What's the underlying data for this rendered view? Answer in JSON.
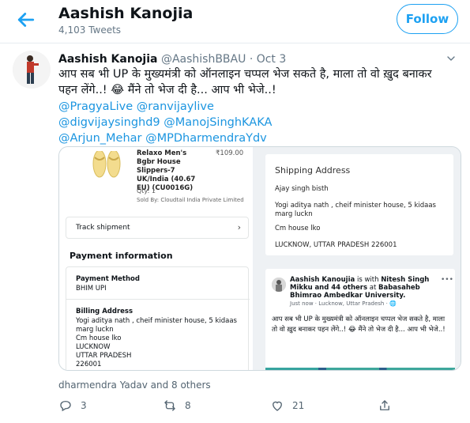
{
  "header": {
    "name": "Aashish Kanojia",
    "tweet_count": "4,103 Tweets",
    "follow_label": "Follow"
  },
  "tweet": {
    "author_name": "Aashish Kanojia",
    "author_handle": "@AashishBBAU",
    "separator": "·",
    "date": "Oct 3",
    "text_line1": "आप सब भी UP के मुख्यमंत्री को ऑनलाइन चप्पल भेज सकते है, माला तो वो ख़ुद बनाकर",
    "text_line2": "पहन लेंगे..! 😂 मैंने तो भेज दी है... आप भी भेजे..!",
    "mentions": [
      "@PragyaLive @ranvijaylive",
      "@digvijaysinghd9 @ManojSinghKAKA",
      "@Arjun_Mehar @MPDharmendraYdv"
    ],
    "likers": "dharmendra Yadav and 8 others",
    "actions": {
      "replies": "3",
      "retweets": "8",
      "likes": "21"
    }
  },
  "media": {
    "order": {
      "product_name": "Relaxo Men's Bgbr House Slippers-7 UK/India (40.67 EU) (CU0016G)",
      "price": "₹109.00",
      "qty": "Qty: 1",
      "sold_by": "Sold By: Cloudtail India Private Limited",
      "track_label": "Track shipment",
      "payment_title": "Payment information",
      "payment_method_label": "Payment Method",
      "payment_method_value": "BHIM UPI",
      "billing_label": "Billing Address",
      "billing_lines": [
        "Yogi aditya nath , cheif minister house, 5 kidaas",
        "marg luckn",
        "Cm house lko",
        "LUCKNOW",
        "UTTAR PRADESH",
        "226001"
      ]
    },
    "shipping": {
      "title": "Shipping Address",
      "name": "Ajay singh bisth",
      "line1": "Yogi aditya nath , cheif minister house, 5 kidaas marg luckn",
      "line2": "Cm house lko",
      "line3": "LUCKNOW, UTTAR PRADESH 226001"
    },
    "fb_post": {
      "author": "Aashish Kanoujia",
      "is_with": "is with",
      "with_name": "Nitesh Singh Mikku",
      "and_others": "and 44 others",
      "at": "at",
      "place": "Babasaheb Bhimrao Ambedkar University.",
      "meta": "Just now · Lucknow, Uttar Pradesh · 🌐",
      "dots": "•••",
      "text": "आप सब भी UP के मुख्यमंत्री को ऑनलाइन चप्पल भेज सकते है, माला तो वो ख़ुद बनाकर पहन लेंगे..! 😂 मैंने तो भेज दी है... आप भी भेजे..!"
    }
  },
  "colors": {
    "accent": "#1da1f2",
    "link": "#1b95e0",
    "muted": "#657786"
  }
}
